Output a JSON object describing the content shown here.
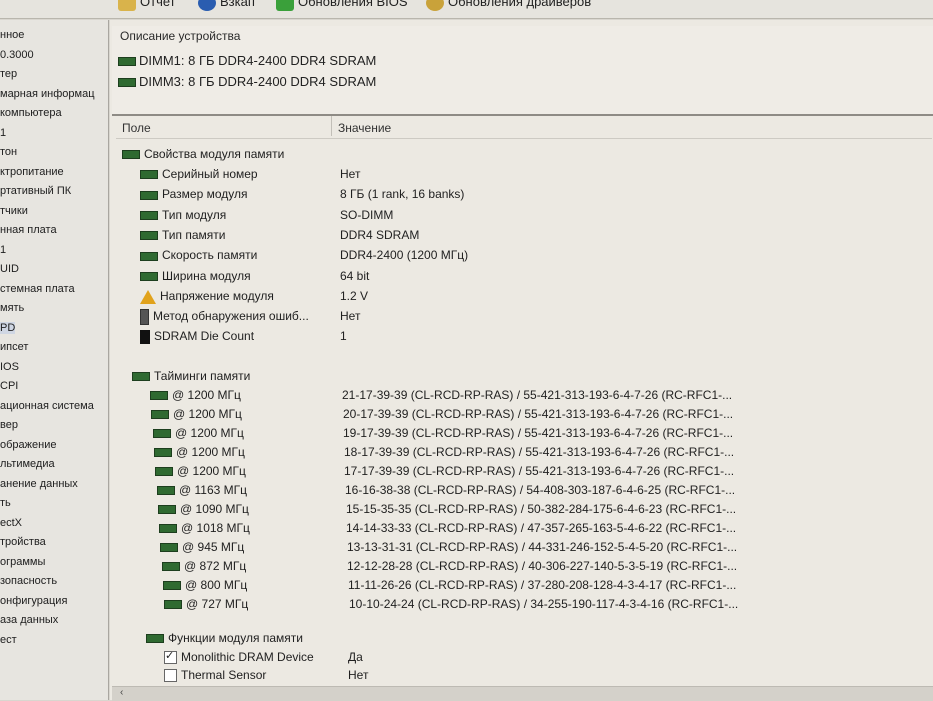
{
  "toolbar": {
    "items": [
      {
        "label": "Отчет",
        "icon": "report-icon",
        "color": "#d9b34b"
      },
      {
        "label": "Взкап",
        "icon": "globe-icon",
        "color": "#2a5db0"
      },
      {
        "label": "Обновления BIOS",
        "icon": "update-icon",
        "color": "#3aa03a"
      },
      {
        "label": "Обновления драйверов",
        "icon": "search-icon",
        "color": "#c9a23a"
      }
    ]
  },
  "sidebar": {
    "items": [
      "нное",
      "0.3000",
      "тер",
      "марная информац",
      "компьютера",
      "1",
      "тон",
      "ктропитание",
      "ртативный ПК",
      "тчики",
      "нная плата",
      "1",
      "UID",
      "стемная плата",
      "мять",
      "PD",
      "ипсет",
      "IOS",
      "CPI",
      "ационная система",
      "вер",
      "ображение",
      "льтимедиа",
      "анение данных",
      "ть",
      "ectX",
      "тройства",
      "ограммы",
      "зопасность",
      "онфигурация",
      "аза данных",
      "ест"
    ],
    "selected_index": 15
  },
  "description": {
    "title": "Описание устройства",
    "lines": [
      "DIMM1: 8 ГБ DDR4-2400 DDR4 SDRAM",
      "DIMM3: 8 ГБ DDR4-2400 DDR4 SDRAM"
    ]
  },
  "columns": {
    "field": "Поле",
    "value": "Значение"
  },
  "properties": {
    "group": "Свойства модуля памяти",
    "rows": [
      {
        "name": "Серийный номер",
        "value": "Нет",
        "icon": "memory-chip-icon"
      },
      {
        "name": "Размер модуля",
        "value": "8 ГБ (1 rank, 16 banks)",
        "icon": "memory-chip-icon"
      },
      {
        "name": "Тип модуля",
        "value": "SO-DIMM",
        "icon": "memory-chip-icon"
      },
      {
        "name": "Тип памяти",
        "value": "DDR4 SDRAM",
        "icon": "memory-chip-icon"
      },
      {
        "name": "Скорость памяти",
        "value": "DDR4-2400 (1200 МГц)",
        "icon": "memory-chip-icon"
      },
      {
        "name": "Ширина модуля",
        "value": "64 bit",
        "icon": "memory-chip-icon"
      },
      {
        "name": "Напряжение модуля",
        "value": "1.2 V",
        "icon": "warning-icon"
      },
      {
        "name": "Метод обнаружения ошиб...",
        "value": "Нет",
        "icon": "device-icon"
      },
      {
        "name": "SDRAM Die Count",
        "value": "1",
        "icon": "chip-icon"
      }
    ]
  },
  "timings": {
    "group": "Тайминги памяти",
    "rows": [
      {
        "freq": "@ 1200 МГц",
        "value": "21-17-39-39  (CL-RCD-RP-RAS) / 55-421-313-193-6-4-7-26  (RC-RFC1-..."
      },
      {
        "freq": "@ 1200 МГц",
        "value": "20-17-39-39  (CL-RCD-RP-RAS) / 55-421-313-193-6-4-7-26  (RC-RFC1-..."
      },
      {
        "freq": "@ 1200 МГц",
        "value": "19-17-39-39  (CL-RCD-RP-RAS) / 55-421-313-193-6-4-7-26  (RC-RFC1-..."
      },
      {
        "freq": "@ 1200 МГц",
        "value": "18-17-39-39  (CL-RCD-RP-RAS) / 55-421-313-193-6-4-7-26  (RC-RFC1-..."
      },
      {
        "freq": "@ 1200 МГц",
        "value": "17-17-39-39  (CL-RCD-RP-RAS) / 55-421-313-193-6-4-7-26  (RC-RFC1-..."
      },
      {
        "freq": "@ 1163 МГц",
        "value": "16-16-38-38  (CL-RCD-RP-RAS) / 54-408-303-187-6-4-6-25  (RC-RFC1-..."
      },
      {
        "freq": "@ 1090 МГц",
        "value": "15-15-35-35  (CL-RCD-RP-RAS) / 50-382-284-175-6-4-6-23  (RC-RFC1-..."
      },
      {
        "freq": "@ 1018 МГц",
        "value": "14-14-33-33  (CL-RCD-RP-RAS) / 47-357-265-163-5-4-6-22  (RC-RFC1-..."
      },
      {
        "freq": "@ 945 МГц",
        "value": "13-13-31-31  (CL-RCD-RP-RAS) / 44-331-246-152-5-4-5-20  (RC-RFC1-..."
      },
      {
        "freq": "@ 872 МГц",
        "value": "12-12-28-28  (CL-RCD-RP-RAS) / 40-306-227-140-5-3-5-19  (RC-RFC1-..."
      },
      {
        "freq": "@ 800 МГц",
        "value": "11-11-26-26  (CL-RCD-RP-RAS) / 37-280-208-128-4-3-4-17  (RC-RFC1-..."
      },
      {
        "freq": "@ 727 МГц",
        "value": "10-10-24-24  (CL-RCD-RP-RAS) / 34-255-190-117-4-3-4-16  (RC-RFC1-..."
      }
    ]
  },
  "features": {
    "group": "Функции модуля памяти",
    "rows": [
      {
        "name": "Monolithic DRAM Device",
        "value": "Да",
        "checked": true
      },
      {
        "name": "Thermal Sensor",
        "value": "Нет",
        "checked": false
      }
    ]
  },
  "scrollbar": {
    "left_arrow": "‹"
  }
}
